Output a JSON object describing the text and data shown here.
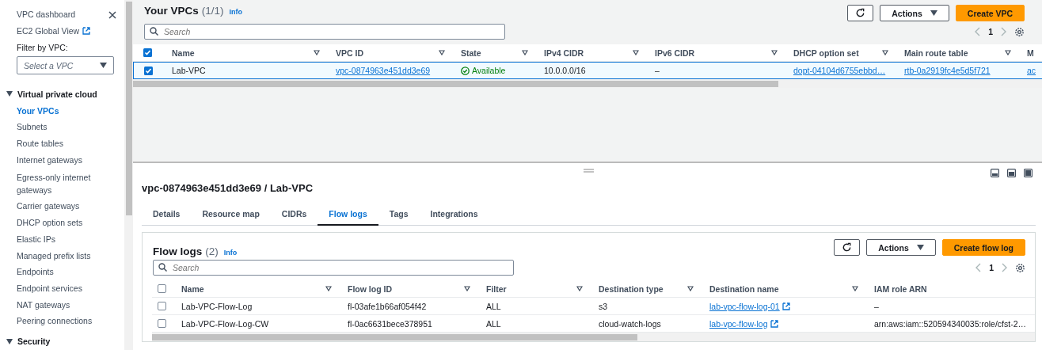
{
  "sidebar": {
    "top_links": [
      {
        "label": "VPC dashboard",
        "external": false
      },
      {
        "label": "EC2 Global View",
        "external": true
      }
    ],
    "filter_label": "Filter by VPC:",
    "filter_select": {
      "placeholder": "Select a VPC"
    },
    "sections": [
      {
        "label": "Virtual private cloud",
        "expanded": true,
        "items": [
          {
            "label": "Your VPCs",
            "selected": true
          },
          {
            "label": "Subnets",
            "selected": false
          },
          {
            "label": "Route tables",
            "selected": false
          },
          {
            "label": "Internet gateways",
            "selected": false
          },
          {
            "label": "Egress-only internet gateways",
            "selected": false
          },
          {
            "label": "Carrier gateways",
            "selected": false
          },
          {
            "label": "DHCP option sets",
            "selected": false
          },
          {
            "label": "Elastic IPs",
            "selected": false
          },
          {
            "label": "Managed prefix lists",
            "selected": false
          },
          {
            "label": "Endpoints",
            "selected": false
          },
          {
            "label": "Endpoint services",
            "selected": false
          },
          {
            "label": "NAT gateways",
            "selected": false
          },
          {
            "label": "Peering connections",
            "selected": false
          }
        ]
      },
      {
        "label": "Security",
        "expanded": true
      }
    ]
  },
  "vpcs": {
    "title": "Your VPCs",
    "count": "(1/1)",
    "info": "Info",
    "buttons": [
      {
        "kind": "refresh"
      },
      {
        "kind": "menu",
        "label": "Actions"
      },
      {
        "kind": "primary",
        "label": "Create VPC"
      }
    ],
    "search": {
      "placeholder": "Search"
    },
    "page": "1",
    "all_selected": true,
    "columns": [
      "Name",
      "VPC ID",
      "State",
      "IPv4 CIDR",
      "IPv6 CIDR",
      "DHCP option set",
      "Main route table",
      "M"
    ],
    "rows": [
      {
        "selected": true,
        "cells": [
          {
            "kind": "text",
            "text": "Lab-VPC"
          },
          {
            "kind": "link",
            "text": "vpc-0874963e451dd3e69"
          },
          {
            "kind": "status",
            "text": "Available"
          },
          {
            "kind": "text",
            "text": "10.0.0.0/16"
          },
          {
            "kind": "text",
            "text": "–"
          },
          {
            "kind": "link",
            "text": "dopt-04104d6755ebbd…"
          },
          {
            "kind": "link",
            "text": "rtb-0a2919fc4e5d5f721"
          },
          {
            "kind": "link",
            "text": "ac"
          }
        ]
      }
    ]
  },
  "detail": {
    "title": "vpc-0874963e451dd3e69 / Lab-VPC",
    "tabs": [
      {
        "label": "Details",
        "selected": false
      },
      {
        "label": "Resource map",
        "selected": false
      },
      {
        "label": "CIDRs",
        "selected": false
      },
      {
        "label": "Flow logs",
        "selected": true
      },
      {
        "label": "Tags",
        "selected": false
      },
      {
        "label": "Integrations",
        "selected": false
      }
    ],
    "flow_logs": {
      "title": "Flow logs",
      "count": "(2)",
      "info": "Info",
      "buttons": [
        {
          "kind": "refresh"
        },
        {
          "kind": "menu",
          "label": "Actions"
        },
        {
          "kind": "primary",
          "label": "Create flow log"
        }
      ],
      "search": {
        "placeholder": "Search"
      },
      "page": "1",
      "all_selected": false,
      "columns": [
        "Name",
        "Flow log ID",
        "Filter",
        "Destination type",
        "Destination name",
        "IAM role ARN"
      ],
      "rows": [
        {
          "selected": false,
          "cells": [
            {
              "kind": "text",
              "text": "Lab-VPC-Flow-Log"
            },
            {
              "kind": "text",
              "text": "fl-03afe1b66af054f42"
            },
            {
              "kind": "text",
              "text": "ALL"
            },
            {
              "kind": "text",
              "text": "s3"
            },
            {
              "kind": "external",
              "text": "lab-vpc-flow-log-01"
            },
            {
              "kind": "text",
              "text": "–"
            }
          ]
        },
        {
          "selected": false,
          "cells": [
            {
              "kind": "text",
              "text": "Lab-VPC-Flow-Log-CW"
            },
            {
              "kind": "text",
              "text": "fl-0ac6631bece378951"
            },
            {
              "kind": "text",
              "text": "ALL"
            },
            {
              "kind": "text",
              "text": "cloud-watch-logs"
            },
            {
              "kind": "external",
              "text": "lab-vpc-flow-log"
            },
            {
              "kind": "text",
              "text": "arn:aws:iam::520594340035:role/cfst-2…"
            }
          ]
        }
      ]
    }
  }
}
